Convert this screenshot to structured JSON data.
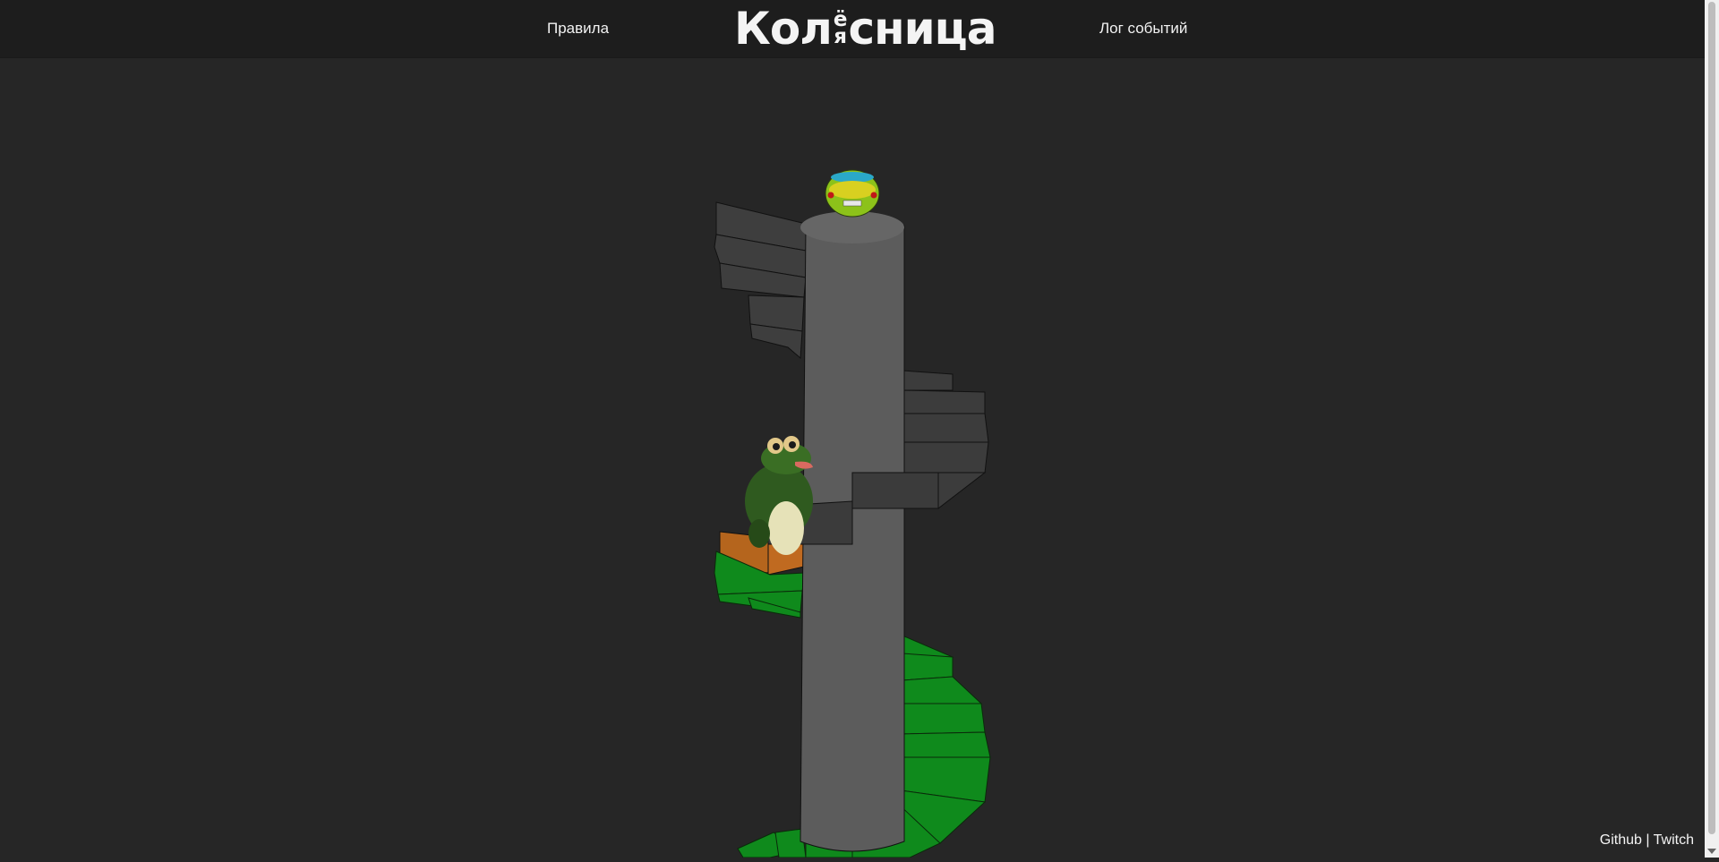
{
  "header": {
    "rules_label": "Правила",
    "event_log_label": "Лог событий",
    "logo": {
      "prefix": "Кол",
      "stack_top": "ё",
      "stack_bottom": "я",
      "suffix": "сница"
    }
  },
  "footer": {
    "github_label": "Github",
    "separator": "|",
    "twitch_label": "Twitch"
  },
  "game": {
    "board": "spiral-staircase",
    "colors": {
      "background": "#262626",
      "header": "#1d1d1d",
      "pillar": "#5c5c5c",
      "stair_gray": "#3c3c3c",
      "stair_green": "#0e8a1c",
      "stair_orange": "#b5651d"
    },
    "tokens": [
      {
        "icon": "car-token-icon",
        "color": "#8cc21a"
      },
      {
        "icon": "frog-player-icon",
        "color": "#2f5a1f"
      }
    ]
  }
}
